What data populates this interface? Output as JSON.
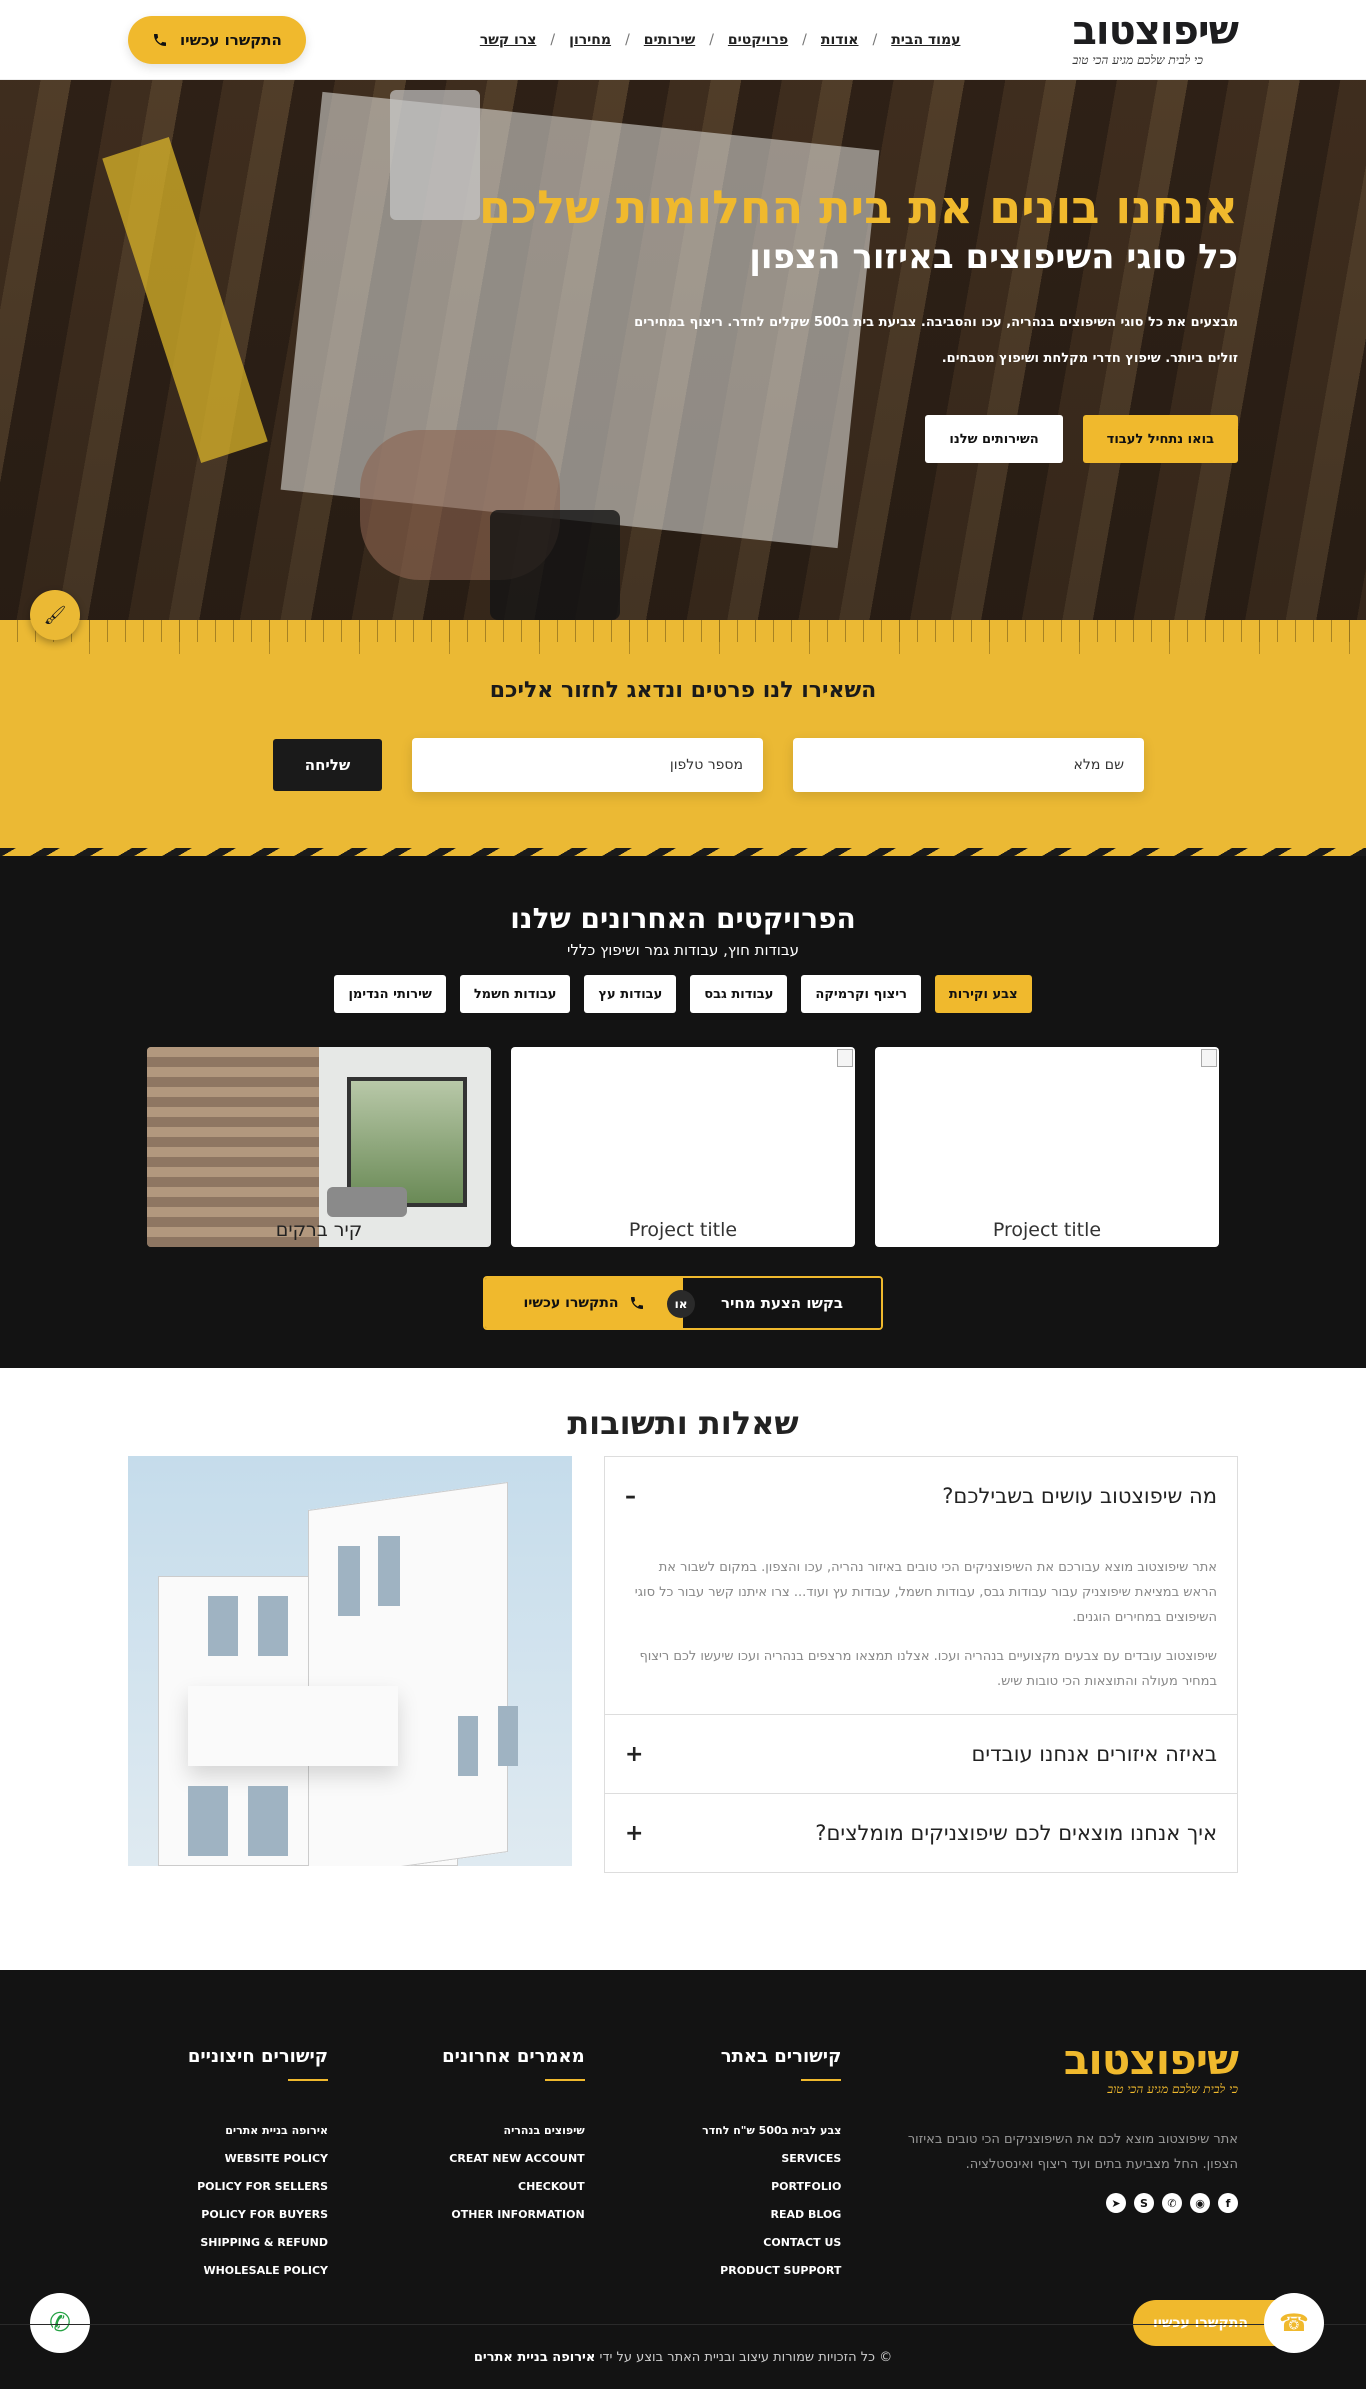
{
  "header": {
    "logo_title": "שיפוצטוב",
    "logo_sub": "כי לבית שלכם מגיע הכי טוב",
    "nav": [
      "עמוד הבית",
      "אודות",
      "פרויקטים",
      "שירותים",
      "מחירון",
      "צרו קשר"
    ],
    "cta_label": "התקשרו עכשיו"
  },
  "hero": {
    "title": "אנחנו בונים את בית החלומות שלכם",
    "subtitle": "כל סוגי השיפוצים באיזור הצפון",
    "text_line1": "מבצעים את כל סוגי השיפוצים בנהריה, עכו והסביבה. צביעת בית ב500 שקלים לחדר. ריצוף במחירים",
    "text_line2": "זולים ביותר. שיפוץ חדרי מקלחת ושיפוץ מטבחים.",
    "btn_primary": "בואו נתחיל לעבוד",
    "btn_secondary": "השירותים שלנו"
  },
  "lead": {
    "title": "השאירו לנו פרטים ונדאג לחזור אליכם",
    "name_placeholder": "שם מלא",
    "phone_placeholder": "מספר טלפון",
    "submit": "שליחה"
  },
  "projects": {
    "title": "הפרויקטים האחרונים שלנו",
    "subtitle": "עבודות חוץ, עבודות גמר ושיפוץ כללי",
    "filters": [
      "צבע וקירות",
      "ריצוף וקרמיקה",
      "עבודות גבס",
      "עבודות עץ",
      "עבודות חשמל",
      "שירותי הנדימן"
    ],
    "cards": [
      "Project title",
      "Project title",
      "קיר ברקים"
    ],
    "cta_quote": "בקשו הצעת מחיר",
    "cta_or": "או",
    "cta_call": "התקשרו עכשיו"
  },
  "faq": {
    "title": "שאלות ותשובות",
    "items": [
      {
        "q": "מה שיפוצטוב עושים בשבילכם?",
        "sign": "–"
      },
      {
        "q": "באיזה איזורים אנחנו עובדים",
        "sign": "+"
      },
      {
        "q": "איך אנחנו מוצאים לכם שיפוצניקים מומלצים?",
        "sign": "+"
      }
    ],
    "answer_p1": "אתר שיפוצטוב מוצא עבורכם את השיפוצניקים הכי טובים באיזור נהריה, עכו והצפון. במקום לשבור את הראש במציאת שיפוצניק עבור עבודות גבס, עבודות חשמל, עבודות עץ ועוד... צרו איתנו קשר עבור כל סוגי השיפוצים במחירים הוגנים.",
    "answer_p2": "שיפוצטוב עובדים עם צבעים מקצועיים בנהריה ועכו. אצלנו תמצאו מרצפים בנהריה ועכו שיעשו לכם ריצוף במחיר מעולה והתוצאות הכי טובות שיש."
  },
  "footer": {
    "logo_title": "שיפוצטוב",
    "logo_sub": "כי לבית שלכם מגיע הכי טוב",
    "about": "אתר שיפוצטוב מוצא לכם את השיפוצניקים הכי טובים באיזור הצפון. החל מצביעת בתים ועד ריצוף ואינסטלציה.",
    "col1_head": "קישורים באתר",
    "col1_links": [
      "צבע לבית ב500 ש\"ח לחדר",
      "SERVICES",
      "PORTFOLIO",
      "READ BLOG",
      "CONTACT US",
      "PRODUCT SUPPORT"
    ],
    "col2_head": "מאמרים אחרונים",
    "col2_links": [
      "שיפוצים בנהריה",
      "CREAT NEW ACCOUNT",
      "CHECKOUT",
      "OTHER INFORMATION"
    ],
    "col3_head": "קישורים חיצוניים",
    "col3_links": [
      "אירופה בניית אתרים",
      "WEBSITE POLICY",
      "POLICY FOR SELLERS",
      "POLICY FOR BUYERS",
      "SHIPPING & REFUND",
      "WHOLESALE POLICY"
    ],
    "copyright_prefix": "© כל הזכויות שמורות עיצוב ובניית האתר בוצע על ידי",
    "copyright_brand": "אירופה בניית אתרים",
    "float_call": "התקשרו עכשיו"
  },
  "colors": {
    "accent": "#f0b92d",
    "dark": "#131313"
  }
}
